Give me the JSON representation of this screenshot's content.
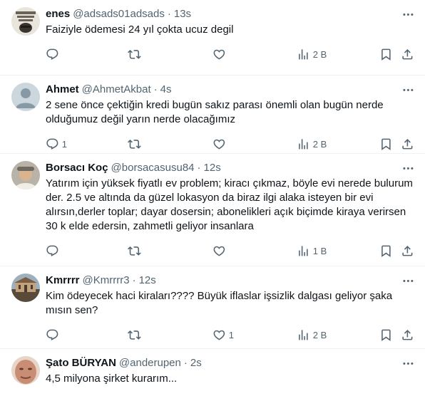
{
  "tweets": [
    {
      "name": "enes",
      "handle": "@adsads01adsads",
      "time": "13s",
      "text": "Faiziyle ödemesi 24 yıl çokta ucuz degil",
      "replies": "",
      "retweets": "",
      "likes": "",
      "views": "2 B",
      "avatar": "text-logo-avatar"
    },
    {
      "name": "Ahmet",
      "handle": "@AhmetAkbat",
      "time": "4s",
      "text": "2 sene önce çektiğin kredi bugün sakız parası önemli olan bugün nerde olduğumuz değil yarın nerde olacağımız",
      "replies": "1",
      "retweets": "",
      "likes": "",
      "views": "2 B",
      "avatar": "default-avatar"
    },
    {
      "name": "Borsacı Koç",
      "handle": "@borsacasusu84",
      "time": "12s",
      "text": "Yatırım için yüksek fiyatlı ev problem; kiracı çıkmaz, böyle evi nerede bulurum der. 2.5 ve altında da güzel lokasyon da biraz ilgi alaka isteyen bir evi alırsın,derler toplar; dayar dosersin; abonelikleri açık biçimde kiraya verirsen 30 k elde edersin, zahmetli geliyor insanlara",
      "replies": "",
      "retweets": "",
      "likes": "",
      "views": "1 B",
      "avatar": "photo-avatar"
    },
    {
      "name": "Kmrrrr",
      "handle": "@Kmrrrr3",
      "time": "12s",
      "text": "Kim ödeyecek haci kiraları???? Büyük iflaslar işsizlik dalgası geliyor şaka mısın sen?",
      "replies": "",
      "retweets": "",
      "likes": "1",
      "views": "2 B",
      "avatar": "building-avatar"
    },
    {
      "name": "Şato BÜRYAN",
      "handle": "@anderupen",
      "time": "2s",
      "text": "4,5 milyona şirket kurarım...",
      "avatar": "face-avatar"
    }
  ],
  "icons": {
    "more": "more-horizontal-icon",
    "reply": "reply-icon",
    "retweet": "retweet-icon",
    "like": "like-icon",
    "views": "views-icon",
    "bookmark": "bookmark-icon",
    "share": "share-icon"
  },
  "colors": {
    "text": "#0f1419",
    "muted": "#536471",
    "divider": "#eff3f4"
  }
}
